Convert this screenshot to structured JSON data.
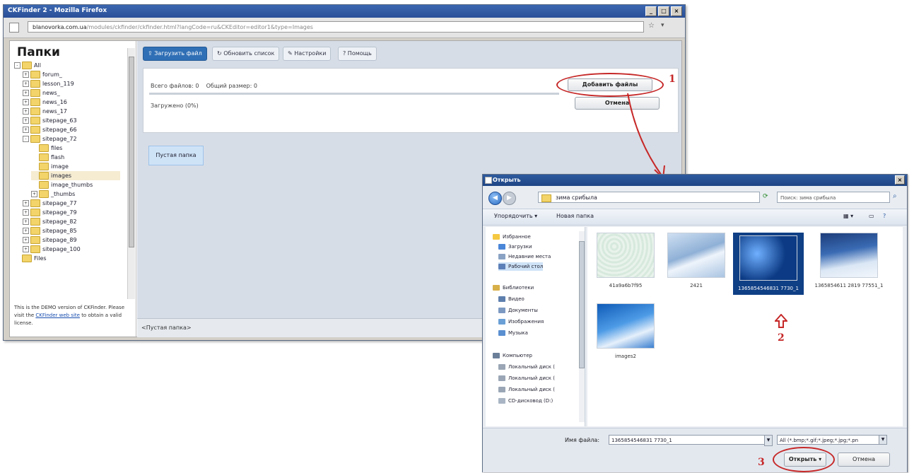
{
  "firefox": {
    "title": "CKFinder 2 - Mozilla Firefox",
    "url_domain": "blanovorka.com.ua",
    "url_rest": "/modules/ckfinder/ckfinder.html?langCode=ru&CKEditor=editor1&type=Images",
    "folders_heading": "Папки",
    "tree": [
      {
        "label": "All",
        "expander": "-",
        "indent": 0
      },
      {
        "label": "forum_",
        "expander": "+",
        "indent": 1
      },
      {
        "label": "lesson_119",
        "expander": "+",
        "indent": 1
      },
      {
        "label": "news_",
        "expander": "+",
        "indent": 1
      },
      {
        "label": "news_16",
        "expander": "+",
        "indent": 1
      },
      {
        "label": "news_17",
        "expander": "+",
        "indent": 1
      },
      {
        "label": "sitepage_63",
        "expander": "+",
        "indent": 1
      },
      {
        "label": "sitepage_66",
        "expander": "+",
        "indent": 1
      },
      {
        "label": "sitepage_72",
        "expander": "-",
        "indent": 1
      },
      {
        "label": "files",
        "expander": "",
        "indent": 2
      },
      {
        "label": "flash",
        "expander": "",
        "indent": 2
      },
      {
        "label": "image",
        "expander": "",
        "indent": 2
      },
      {
        "label": "images",
        "expander": "",
        "indent": 2,
        "selected": true
      },
      {
        "label": "image_thumbs",
        "expander": "",
        "indent": 2
      },
      {
        "label": "_thumbs",
        "expander": "+",
        "indent": 2
      },
      {
        "label": "sitepage_77",
        "expander": "+",
        "indent": 1
      },
      {
        "label": "sitepage_79",
        "expander": "+",
        "indent": 1
      },
      {
        "label": "sitepage_82",
        "expander": "+",
        "indent": 1
      },
      {
        "label": "sitepage_85",
        "expander": "+",
        "indent": 1
      },
      {
        "label": "sitepage_89",
        "expander": "+",
        "indent": 1
      },
      {
        "label": "sitepage_100",
        "expander": "+",
        "indent": 1
      },
      {
        "label": "Files",
        "expander": "",
        "indent": 0
      }
    ],
    "demo_text_1": "This is the DEMO version of CKFinder. Please visit the",
    "demo_link": "CKFinder web site",
    "demo_text_2": "to obtain a valid license.",
    "tabs": [
      "Загрузить файл",
      "Обновить список",
      "Настройки",
      "Помощь"
    ],
    "total_files_label": "Всего файлов:",
    "total_files_value": "0",
    "total_size_label": "Общий размер:",
    "total_size_value": "0",
    "uploaded_label": "Загружено (0%)",
    "add_files_button": "Добавить файлы",
    "cancel_button": "Отмена",
    "empty_folder": "Пустая папка",
    "status": "<Пустая папка>"
  },
  "annotations": {
    "a1": "1",
    "a2": "2",
    "a3": "3"
  },
  "dialog": {
    "title": "Открыть",
    "breadcrumb": "зима срибыла",
    "search_placeholder": "Поиск: зима срибыла",
    "organize": "Упорядочить",
    "new_folder": "Новая папка",
    "nav": [
      {
        "label": "Избранное",
        "type": "fav"
      },
      {
        "label": "Загрузки",
        "type": "down"
      },
      {
        "label": "Недавние места",
        "type": "recent"
      },
      {
        "label": "Рабочий стол",
        "type": "desk",
        "selected": true
      },
      {
        "label": "Библиотеки",
        "type": "lib"
      },
      {
        "label": "Видео",
        "type": "video"
      },
      {
        "label": "Документы",
        "type": "doc"
      },
      {
        "label": "Изображения",
        "type": "img"
      },
      {
        "label": "Музыка",
        "type": "music"
      },
      {
        "label": "Компьютер",
        "type": "comp"
      },
      {
        "label": "Локальный диск (",
        "type": "disk"
      },
      {
        "label": "Локальный диск (",
        "type": "disk"
      },
      {
        "label": "Локальный диск (",
        "type": "disk"
      },
      {
        "label": "CD-дисковод (D:)",
        "type": "cd"
      }
    ],
    "files": [
      {
        "name": "41a9a6b7f95",
        "style": "pattern"
      },
      {
        "name": "2421",
        "style": "winter1"
      },
      {
        "name": "1365854546831 7730_1",
        "style": "winter2",
        "selected": true
      },
      {
        "name": "1365854611 2819 77551_1",
        "style": "winter3"
      },
      {
        "name": "images2",
        "style": "winter4"
      }
    ],
    "filename_label": "Имя файла:",
    "filename_value": "1365854546831 7730_1",
    "filetype": "All (*.bmp;*.gif;*.jpeg;*.jpg;*.pn",
    "open_button": "Открыть",
    "cancel_button": "Отмена"
  },
  "colors": {
    "accent": "#2f6fb5",
    "annotation": "#c62828"
  }
}
